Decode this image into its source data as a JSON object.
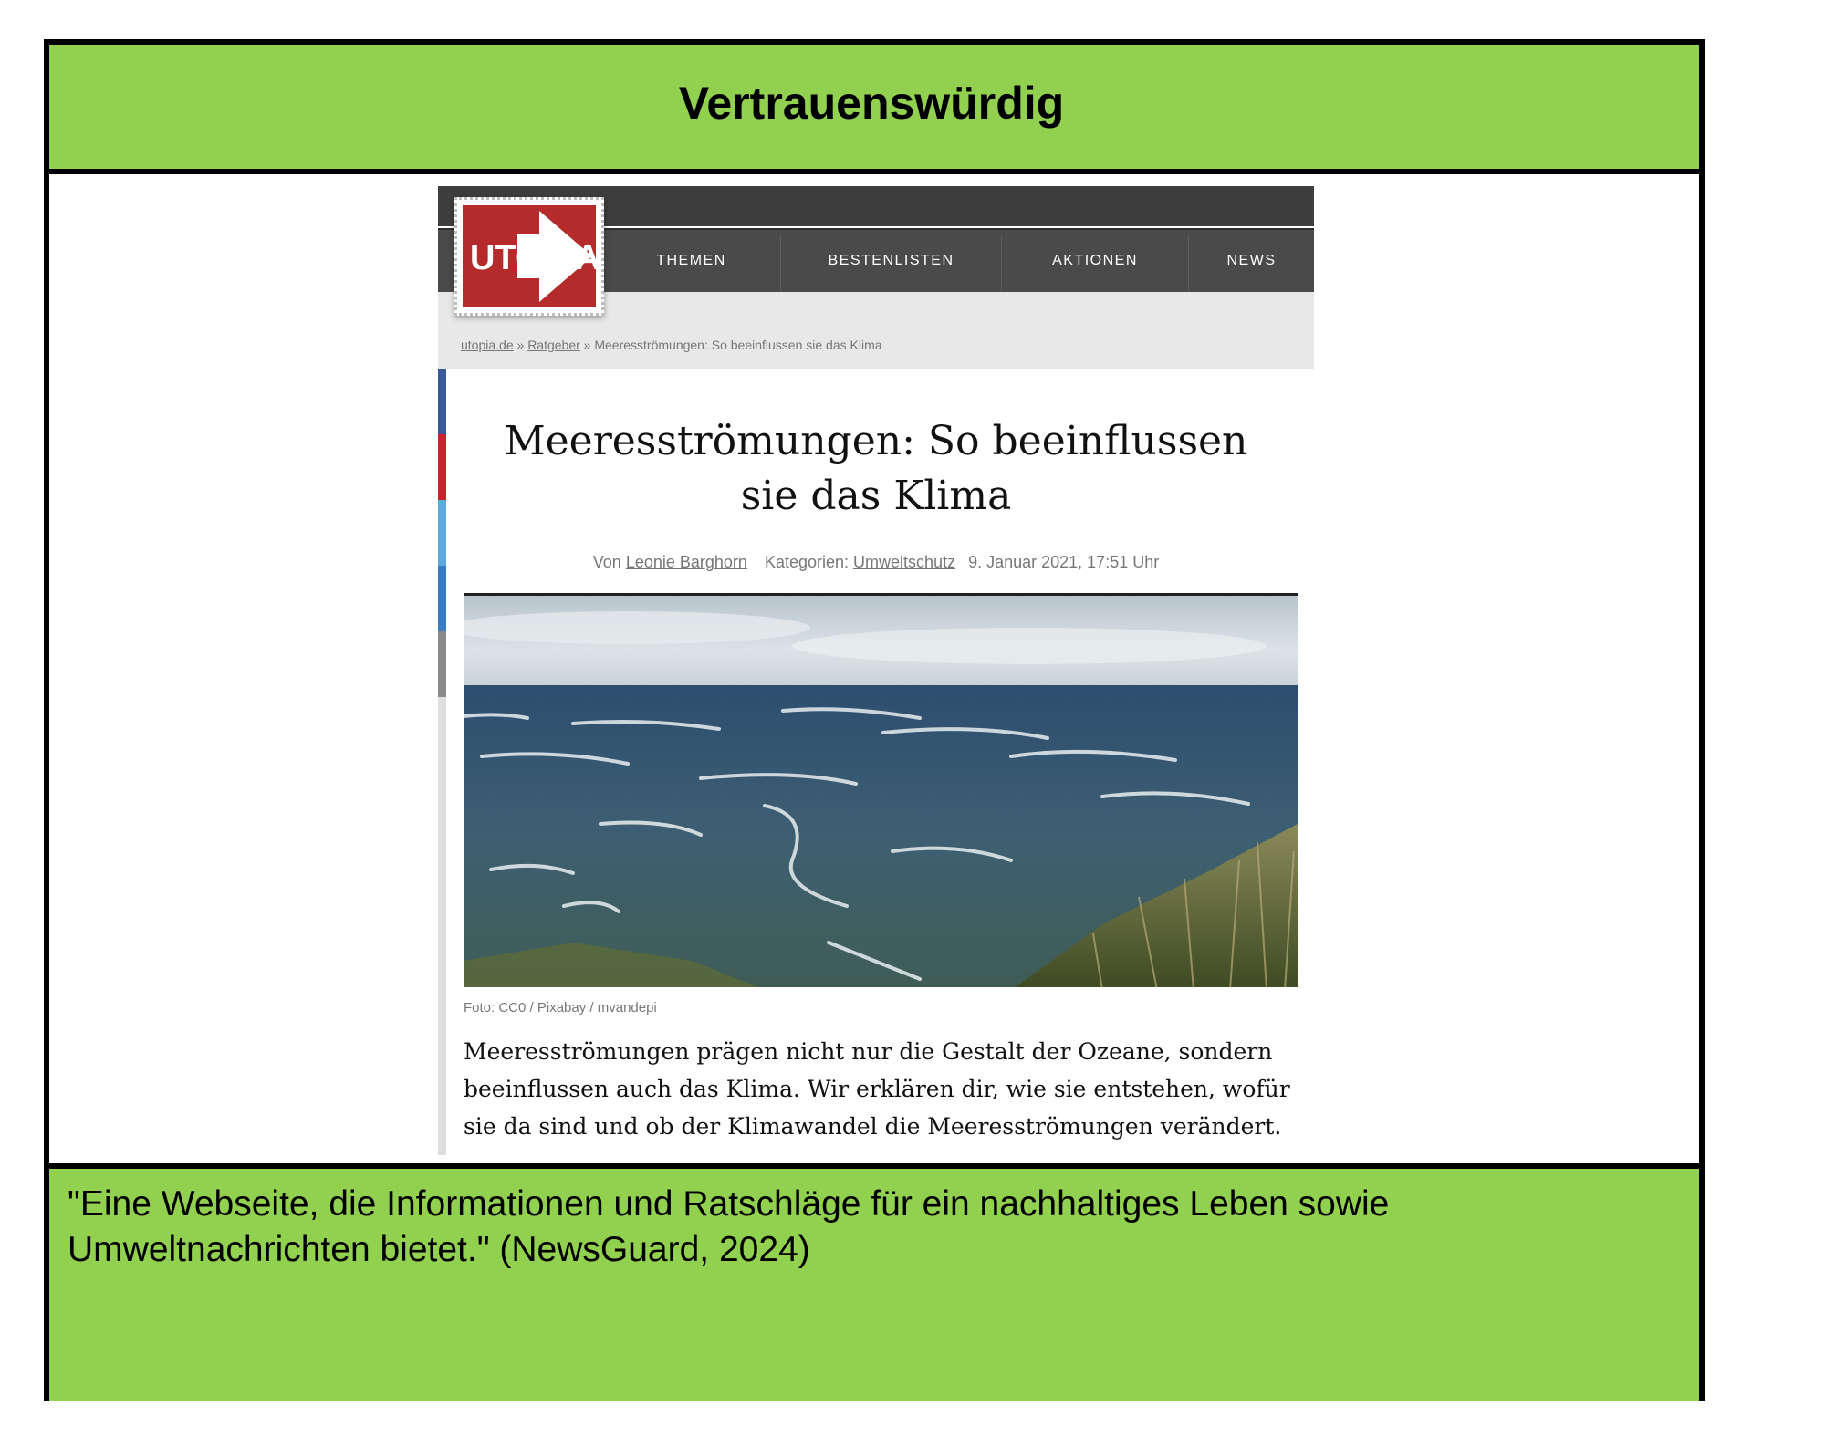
{
  "header": {
    "title": "Vertrauenswürdig"
  },
  "site": {
    "logo_text": "UTOPIA",
    "colors": {
      "brand_red": "#b52a2a",
      "nav_bg": "#4a4a4a",
      "accent_green": "#92d050"
    },
    "nav": [
      "THEMEN",
      "BESTENLISTEN",
      "AKTIONEN",
      "NEWS"
    ],
    "breadcrumb": {
      "home": "utopia.de",
      "sep1": " » ",
      "section": "Ratgeber",
      "sep2": " » ",
      "current": "Meeresströmungen: So beeinflussen sie das Klima"
    }
  },
  "article": {
    "title": "Meeresströmungen: So beeinflussen sie das Klima",
    "meta": {
      "by_label": "Von",
      "author": "Leonie Barghorn",
      "categories_label": "Kategorien:",
      "category": "Umweltschutz",
      "date": "9. Januar 2021, 17:51 Uhr"
    },
    "image_caption": "Foto: CC0 / Pixabay / mvandepi",
    "lead": "Meeresströmungen prägen nicht nur die Gestalt der Ozeane, sondern beeinflussen auch das Klima. Wir erklären dir, wie sie entstehen, wofür sie da sind und ob der Klimawandel die Meeresströmungen verändert."
  },
  "footer": {
    "quote": "\"Eine Webseite, die Informationen und Ratschläge für ein nachhaltiges Leben sowie Umweltnachrichten bietet.\" (NewsGuard, 2024)"
  }
}
